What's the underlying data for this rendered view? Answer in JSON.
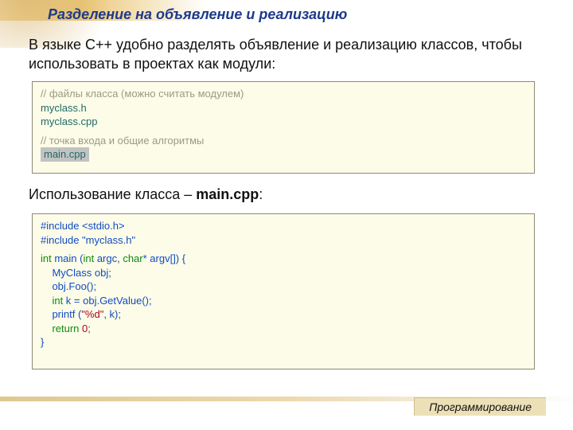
{
  "title": "Разделение на объявление и реализацию",
  "intro": "В языке C++ удобно разделять объявление и реализацию классов, чтобы использовать в проектах как модули:",
  "box1": {
    "c1": "// файлы класса (можно считать модулем)",
    "l1": "myclass.h",
    "l2": "myclass.cpp",
    "c2": "// точка входа и общие алгоритмы",
    "l3": "main.cpp"
  },
  "sub_prefix": "Использование класса – ",
  "sub_bold": "main.cpp",
  "sub_suffix": ":",
  "box2": {
    "inc1_a": "#include ",
    "inc1_b": "<stdio.h>",
    "inc2_a": "#include ",
    "inc2_b": "\"myclass.h\"",
    "int": "int",
    "main_mid": " main (",
    "argc": " argc, ",
    "char": "char",
    "star_argv": "* argv[]) {",
    "obj": "    MyClass obj;",
    "foo": "    obj.Foo();",
    "k_pre": "    ",
    "k_decl": " k = obj.GetValue();",
    "print_pre": "    printf (",
    "fmt": "\"%d\"",
    "print_suf": ", k);",
    "ret_pre": "    ",
    "return": "return",
    "ret_sp": " ",
    "zero": "0",
    "ret_semi": ";",
    "close": "}"
  },
  "footer": "Программирование"
}
